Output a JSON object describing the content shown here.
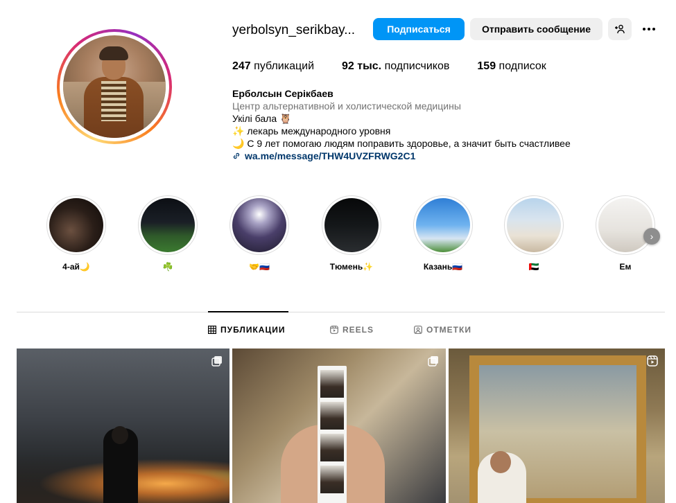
{
  "profile": {
    "username": "yerbolsyn_serikbay...",
    "follow_label": "Подписаться",
    "message_label": "Отправить сообщение",
    "stats": {
      "posts_count": "247",
      "posts_label": "публикаций",
      "followers_count": "92 тыс.",
      "followers_label": "подписчиков",
      "following_count": "159",
      "following_label": "подписок"
    },
    "full_name": "Ерболсын Серікбаев",
    "category": "Центр альтернативной и холистической медицины",
    "bio_lines": [
      "Укілі бала 🦉",
      "✨ лекарь международного уровня",
      "🌙 С 9 лет помогаю людям поправить здоровье, а значит быть счастливее"
    ],
    "link": "wa.me/message/THW4UVZFRWG2C1"
  },
  "highlights": [
    {
      "label": "4-ай🌙"
    },
    {
      "label": "☘️"
    },
    {
      "label": "🤝🇷🇺"
    },
    {
      "label": "Тюмень✨"
    },
    {
      "label": "Казань🇷🇺"
    },
    {
      "label": "🇦🇪"
    },
    {
      "label": "Ем"
    }
  ],
  "tabs": [
    {
      "label": "ПУБЛИКАЦИИ",
      "active": true
    },
    {
      "label": "REELS",
      "active": false
    },
    {
      "label": "ОТМЕТКИ",
      "active": false
    }
  ],
  "colors": {
    "follow_button": "#0095f6",
    "secondary_button": "#efefef",
    "link": "#00376b",
    "muted_text": "#737373"
  },
  "icons": {
    "add_user": "add-user-icon",
    "more": "more-options-icon",
    "link": "link-icon",
    "grid": "grid-icon",
    "reels": "reels-icon",
    "tagged": "tagged-icon",
    "carousel": "carousel-icon",
    "next": "chevron-right-icon"
  }
}
